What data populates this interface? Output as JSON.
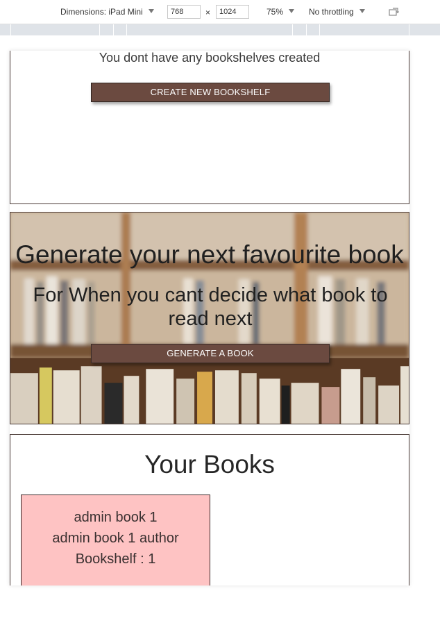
{
  "devtools": {
    "dimensions_label": "Dimensions: iPad Mini",
    "width": "768",
    "height": "1024",
    "times": "×",
    "zoom": "75%",
    "throttling": "No throttling"
  },
  "bookshelves": {
    "empty_message": "You dont have any bookshelves created",
    "create_button": "CREATE NEW BOOKSHELF"
  },
  "generator": {
    "title": "Generate your next favourite book",
    "subtitle": "For When you cant decide what book to read next",
    "button": "GENERATE A BOOK"
  },
  "books": {
    "title": "Your Books",
    "items": [
      {
        "title": "admin book 1",
        "author": "admin book 1 author",
        "shelf": "Bookshelf : 1"
      }
    ]
  },
  "colors": {
    "button_brown": "#6b4a40",
    "book_card_pink": "#fec3c3",
    "border_dark": "#4a3a36"
  }
}
